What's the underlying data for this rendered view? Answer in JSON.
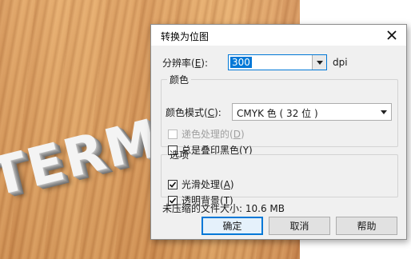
{
  "background": {
    "art_text": "TERM"
  },
  "dialog": {
    "title": "转换为位图",
    "resolution": {
      "label_prefix": "分辨率(",
      "label_key": "E",
      "label_suffix": "):",
      "value": "300",
      "unit": "dpi"
    },
    "color_group": {
      "legend": "颜色",
      "mode_label_prefix": "颜色模式(",
      "mode_label_key": "C",
      "mode_label_suffix": "):",
      "mode_value": "CMYK 色 ( 32 位 )",
      "dither_prefix": "递色处理的(",
      "dither_key": "D",
      "dither_suffix": ")",
      "dither_checked": false,
      "dither_enabled": false,
      "overprint_prefix": "总是叠印黑色(",
      "overprint_key": "Y",
      "overprint_suffix": ")",
      "overprint_checked": false
    },
    "options_group": {
      "legend": "选项",
      "smooth_prefix": "光滑处理(",
      "smooth_key": "A",
      "smooth_suffix": ")",
      "smooth_checked": true,
      "transparent_prefix": "透明背景(",
      "transparent_key": "T",
      "transparent_suffix": ")",
      "transparent_checked": true
    },
    "size_info": "未压缩的文件大小: 10.6 MB",
    "buttons": {
      "ok": "确定",
      "cancel": "取消",
      "help": "帮助"
    }
  },
  "colors": {
    "accent": "#0078d7",
    "dialog_bg": "#f0f0f0"
  },
  "icons": {
    "close": "close-icon",
    "dropdown": "chevron-down-icon",
    "check": "check-icon"
  }
}
